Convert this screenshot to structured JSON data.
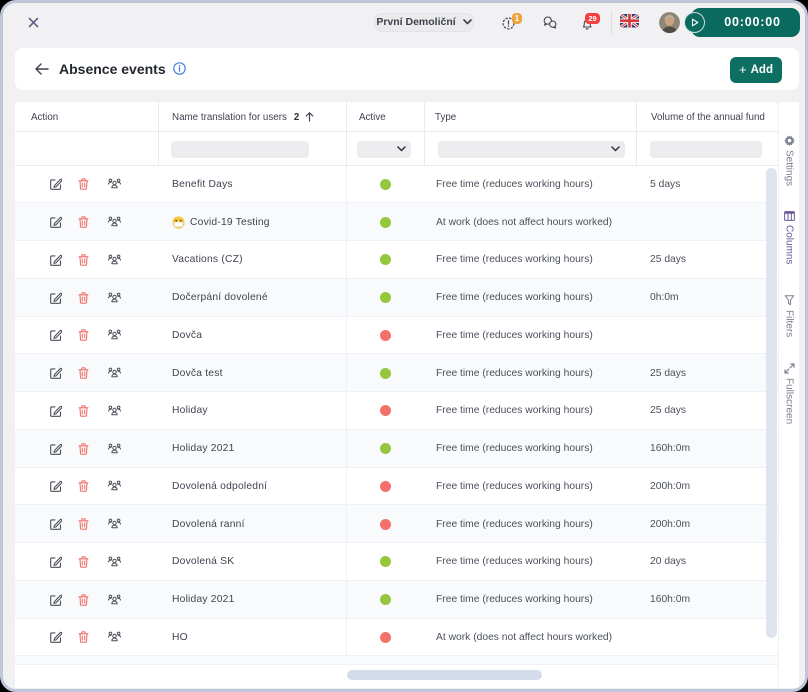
{
  "topbar": {
    "close_icon": "close",
    "company_selector": {
      "label": "První Demoliční",
      "icon": "chevron-down"
    },
    "alerts": {
      "icon": "alert-circle",
      "badge": "1",
      "badge_color": "#f0a43c"
    },
    "chat": {
      "icon": "chat-bubbles"
    },
    "notifications": {
      "icon": "bell",
      "badge": "29",
      "badge_color": "#f4403e"
    },
    "language": {
      "icon": "uk-flag"
    },
    "avatar": {
      "icon": "user-photo"
    },
    "timer": {
      "time": "00:00:00",
      "icon": "play-circle",
      "color": "#0b6a60"
    }
  },
  "header": {
    "back_icon": "arrow-left",
    "title": "Absence events",
    "info_icon": "info-circle",
    "add_button": {
      "label": "Add",
      "plus": "+",
      "color": "#0d6e62"
    }
  },
  "table": {
    "columns": {
      "action": "Action",
      "name": "Name translation for users",
      "name_sort_index": "2",
      "name_sort_icon": "arrow-up",
      "active": "Active",
      "type": "Type",
      "volume": "Volume of the annual fund"
    },
    "filter_row": {
      "name_filter": {
        "value": "",
        "icon": "funnel"
      },
      "active_filter": {
        "value": "",
        "icon": "chevron-down"
      },
      "type_filter": {
        "value": "",
        "icon": "chevron-down"
      },
      "volume_filter": {
        "value": ""
      }
    },
    "action_icons": [
      "edit",
      "delete",
      "users-group"
    ],
    "rows": [
      {
        "name": "Benefit Days",
        "emoji": "",
        "active": "green",
        "type": "Free time (reduces working hours)",
        "volume": "5 days"
      },
      {
        "name": "Covid-19 Testing",
        "emoji": "😷",
        "active": "green",
        "type": "At work (does not affect hours worked)",
        "volume": ""
      },
      {
        "name": "Vacations (CZ)",
        "emoji": "",
        "active": "green",
        "type": "Free time (reduces working hours)",
        "volume": "25 days"
      },
      {
        "name": "Dočerpání dovolené",
        "emoji": "",
        "active": "green",
        "type": "Free time (reduces working hours)",
        "volume": "0h:0m"
      },
      {
        "name": "Dovča",
        "emoji": "",
        "active": "red",
        "type": "Free time (reduces working hours)",
        "volume": ""
      },
      {
        "name": "Dovča test",
        "emoji": "",
        "active": "green",
        "type": "Free time (reduces working hours)",
        "volume": "25 days"
      },
      {
        "name": "Holiday",
        "emoji": "",
        "active": "red",
        "type": "Free time (reduces working hours)",
        "volume": "25 days"
      },
      {
        "name": "Holiday 2021",
        "emoji": "",
        "active": "green",
        "type": "Free time (reduces working hours)",
        "volume": "160h:0m"
      },
      {
        "name": "Dovolená odpolední",
        "emoji": "",
        "active": "red",
        "type": "Free time (reduces working hours)",
        "volume": "200h:0m"
      },
      {
        "name": "Dovolená ranní",
        "emoji": "",
        "active": "red",
        "type": "Free time (reduces working hours)",
        "volume": "200h:0m"
      },
      {
        "name": "Dovolená SK",
        "emoji": "",
        "active": "green",
        "type": "Free time (reduces working hours)",
        "volume": "20 days"
      },
      {
        "name": "Holiday 2021",
        "emoji": "",
        "active": "green",
        "type": "Free time (reduces working hours)",
        "volume": "160h:0m"
      },
      {
        "name": "HO",
        "emoji": "",
        "active": "red",
        "type": "At work (does not affect hours worked)",
        "volume": ""
      }
    ]
  },
  "sidebar": {
    "items": [
      {
        "label": "Settings",
        "icon": "gear",
        "active": false
      },
      {
        "label": "Columns",
        "icon": "columns",
        "active": true
      },
      {
        "label": "Filters",
        "icon": "funnel",
        "active": false
      },
      {
        "label": "Fullscreen",
        "icon": "fullscreen",
        "active": false
      }
    ],
    "active_color": "#6b5898"
  },
  "colors": {
    "teal": "#0d6e62",
    "green_dot": "#96c63e",
    "red_dot": "#f4716b",
    "background": "#f1f1f4",
    "window_border": "#bfc6d8"
  }
}
